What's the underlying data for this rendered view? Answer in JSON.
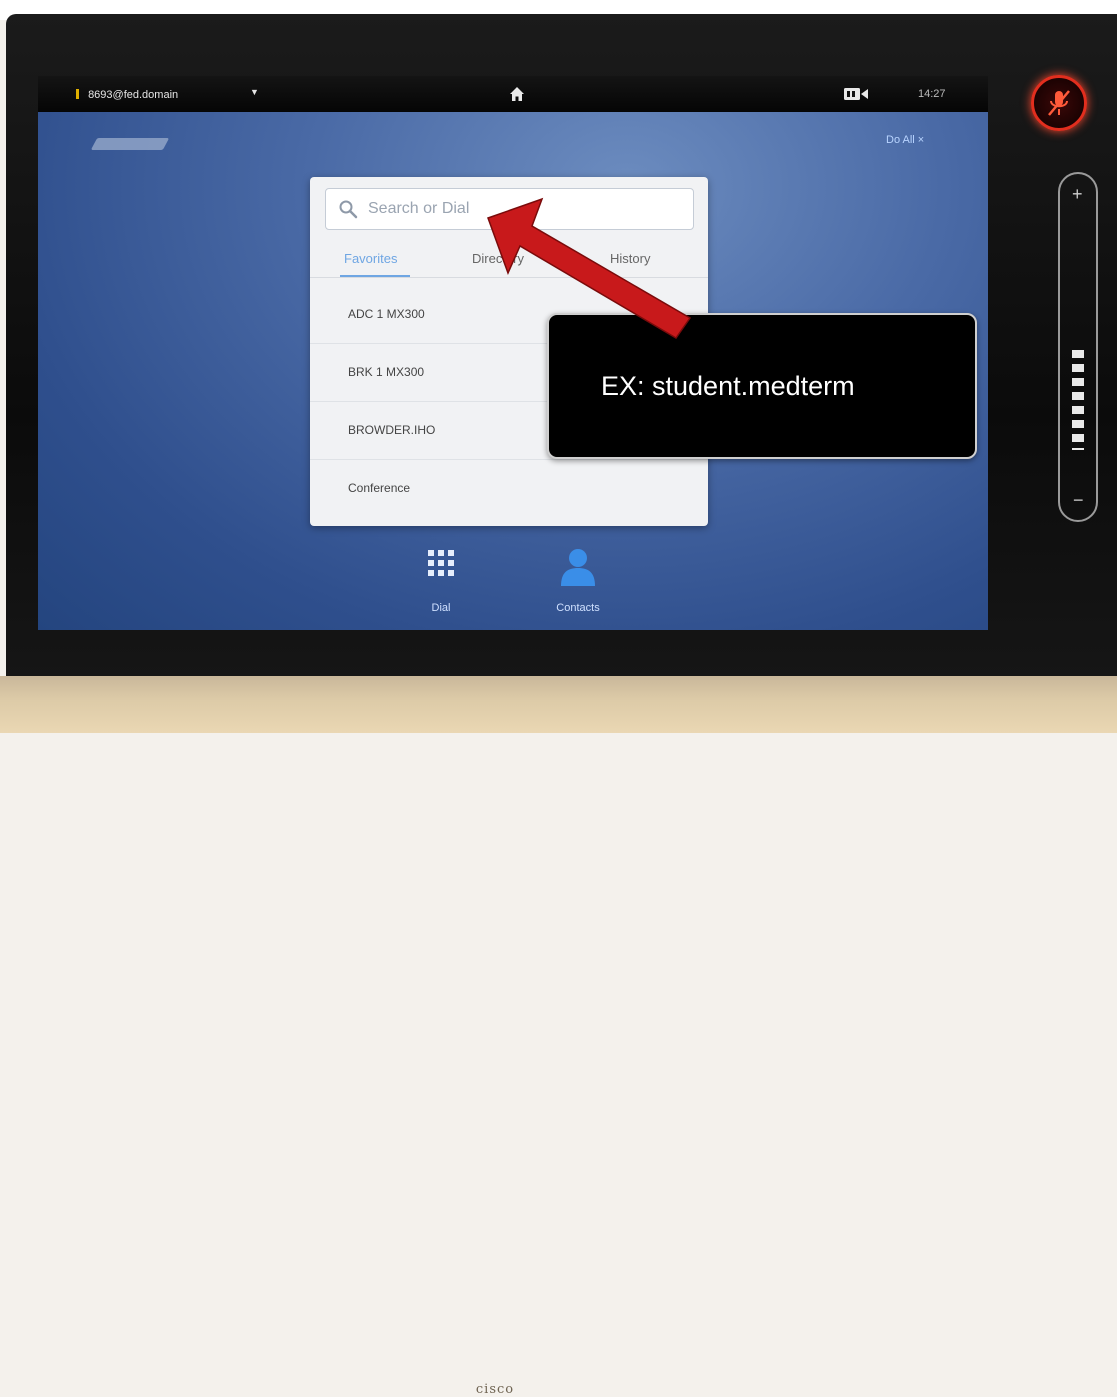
{
  "status_bar": {
    "user": "8693@fed.domain",
    "time": "14:27",
    "icons": [
      "caret-down-icon",
      "home-icon",
      "camera-icon"
    ]
  },
  "top_link": "Do All ×",
  "search": {
    "placeholder": "Search or Dial",
    "value": ""
  },
  "tabs": [
    {
      "label": "Favorites",
      "active": true
    },
    {
      "label": "Directory",
      "active": false
    },
    {
      "label": "History",
      "active": false
    }
  ],
  "list_items": [
    "ADC 1 MX300",
    "BRK 1 MX300",
    "BROWDER.IHO",
    "Conference"
  ],
  "dock": {
    "dial_label": "Dial",
    "contacts_label": "Contacts"
  },
  "callout": {
    "text": "EX: student.medterm"
  },
  "device": {
    "brand": "cisco",
    "volume_level": 0.4
  },
  "colors": {
    "accent": "#6fa6e3",
    "arrow": "#c8191b",
    "mute_ring": "#e22e1e"
  }
}
